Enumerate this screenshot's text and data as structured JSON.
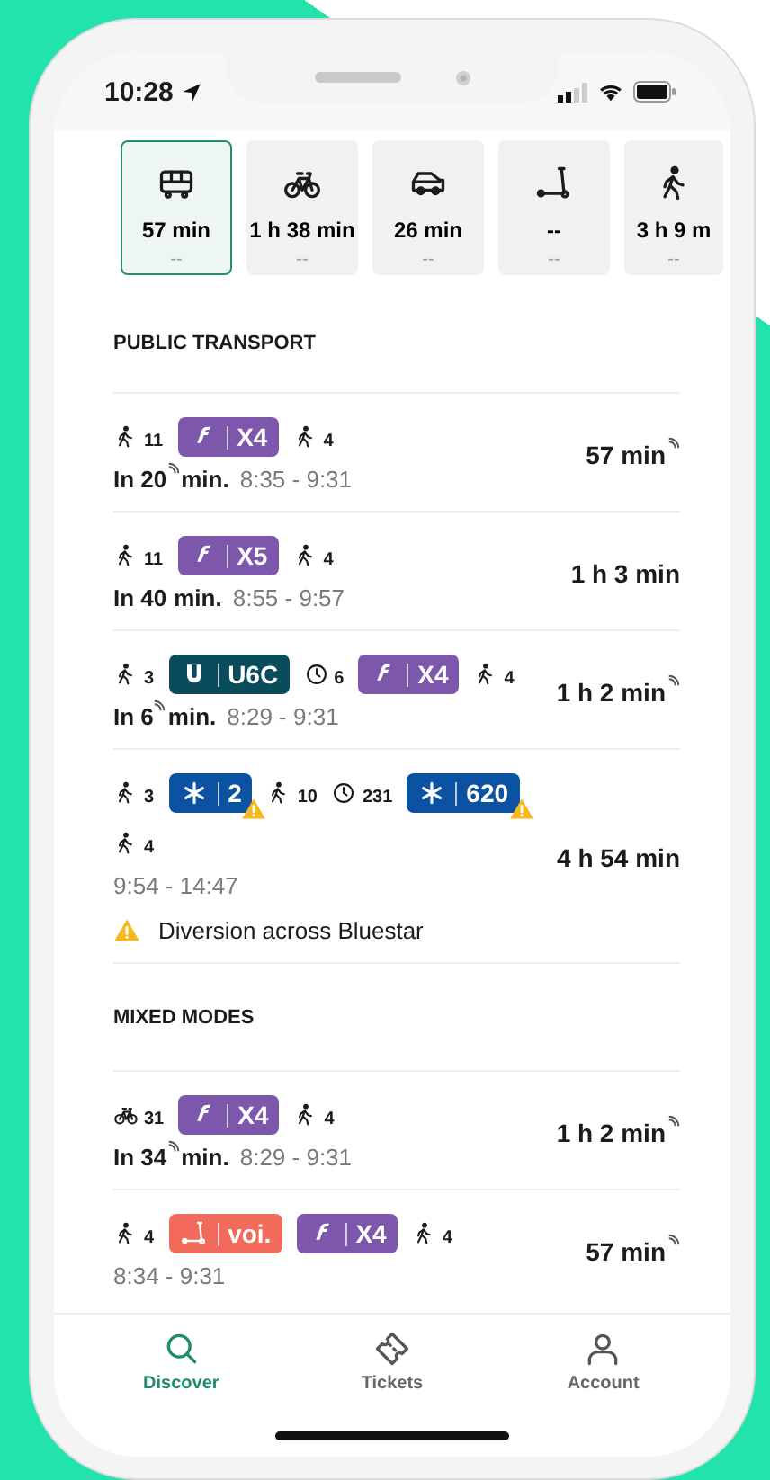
{
  "status_bar": {
    "time": "10:28"
  },
  "modes": [
    {
      "kind": "bus",
      "duration": "57 min",
      "detail": "--",
      "selected": true
    },
    {
      "kind": "bike",
      "duration": "1 h 38 min",
      "detail": "--",
      "selected": false
    },
    {
      "kind": "car",
      "duration": "26 min",
      "detail": "--",
      "selected": false
    },
    {
      "kind": "scooter",
      "duration": "--",
      "detail": "--",
      "selected": false
    },
    {
      "kind": "walk",
      "duration": "3 h 9 m",
      "detail": "--",
      "selected": false
    }
  ],
  "sections": [
    {
      "title": "PUBLIC TRANSPORT",
      "routes": [
        {
          "legs": [
            {
              "kind": "walk",
              "count": "11"
            },
            {
              "kind": "flix_line",
              "label": "X4",
              "color": "#7d57ac",
              "warning": false
            },
            {
              "kind": "walk",
              "count": "4"
            }
          ],
          "depart": {
            "before": "In 20",
            "after": "min.",
            "realtime": true
          },
          "times": "8:35 - 9:31",
          "duration": {
            "text": "57 min",
            "realtime": true
          }
        },
        {
          "legs": [
            {
              "kind": "walk",
              "count": "11"
            },
            {
              "kind": "flix_line",
              "label": "X5",
              "color": "#7d57ac",
              "warning": false
            },
            {
              "kind": "walk",
              "count": "4"
            }
          ],
          "depart": {
            "before": "In 40",
            "after": "min.",
            "realtime": false
          },
          "times": "8:55 - 9:57",
          "duration": {
            "text": "1 h 3 min",
            "realtime": false
          }
        },
        {
          "legs": [
            {
              "kind": "walk",
              "count": "3"
            },
            {
              "kind": "ubahn_line",
              "label": "U6C",
              "color": "#0b4c5c",
              "warning": false
            },
            {
              "kind": "wait",
              "count": "6"
            },
            {
              "kind": "flix_line",
              "label": "X4",
              "color": "#7d57ac",
              "warning": false
            },
            {
              "kind": "walk",
              "count": "4"
            }
          ],
          "depart": {
            "before": "In 6",
            "after": "min.",
            "realtime": true
          },
          "times": "8:29 - 9:31",
          "duration": {
            "text": "1 h 2 min",
            "realtime": true
          }
        },
        {
          "legs": [
            {
              "kind": "walk",
              "count": "3"
            },
            {
              "kind": "star_line",
              "label": "2",
              "color": "#0b52a3",
              "warning": true
            },
            {
              "kind": "walk",
              "count": "10"
            },
            {
              "kind": "wait",
              "count": "231"
            },
            {
              "kind": "star_line",
              "label": "620",
              "color": "#0b52a3",
              "warning": true
            },
            {
              "kind": "walk",
              "count": "4"
            }
          ],
          "times": "9:54 - 14:47",
          "duration": {
            "text": "4 h 54 min",
            "realtime": false
          },
          "alert": "Diversion across Bluestar"
        }
      ]
    },
    {
      "title": "MIXED MODES",
      "routes": [
        {
          "legs": [
            {
              "kind": "bike",
              "count": "31"
            },
            {
              "kind": "flix_line",
              "label": "X4",
              "color": "#7d57ac",
              "warning": false
            },
            {
              "kind": "walk",
              "count": "4"
            }
          ],
          "depart": {
            "before": "In 34",
            "after": "min.",
            "realtime": true
          },
          "times": "8:29 - 9:31",
          "duration": {
            "text": "1 h 2 min",
            "realtime": true
          }
        },
        {
          "legs": [
            {
              "kind": "walk",
              "count": "4"
            },
            {
              "kind": "scooter_line",
              "label": "voi.",
              "color": "#f26a5c",
              "warning": false
            },
            {
              "kind": "flix_line",
              "label": "X4",
              "color": "#7d57ac",
              "warning": false
            },
            {
              "kind": "walk",
              "count": "4"
            }
          ],
          "times": "8:34 - 9:31",
          "duration": {
            "text": "57 min",
            "realtime": true
          }
        }
      ]
    }
  ],
  "tab_bar": [
    {
      "kind": "search",
      "label": "Discover",
      "selected": true
    },
    {
      "kind": "ticket",
      "label": "Tickets",
      "selected": false
    },
    {
      "kind": "person",
      "label": "Account",
      "selected": false
    }
  ]
}
